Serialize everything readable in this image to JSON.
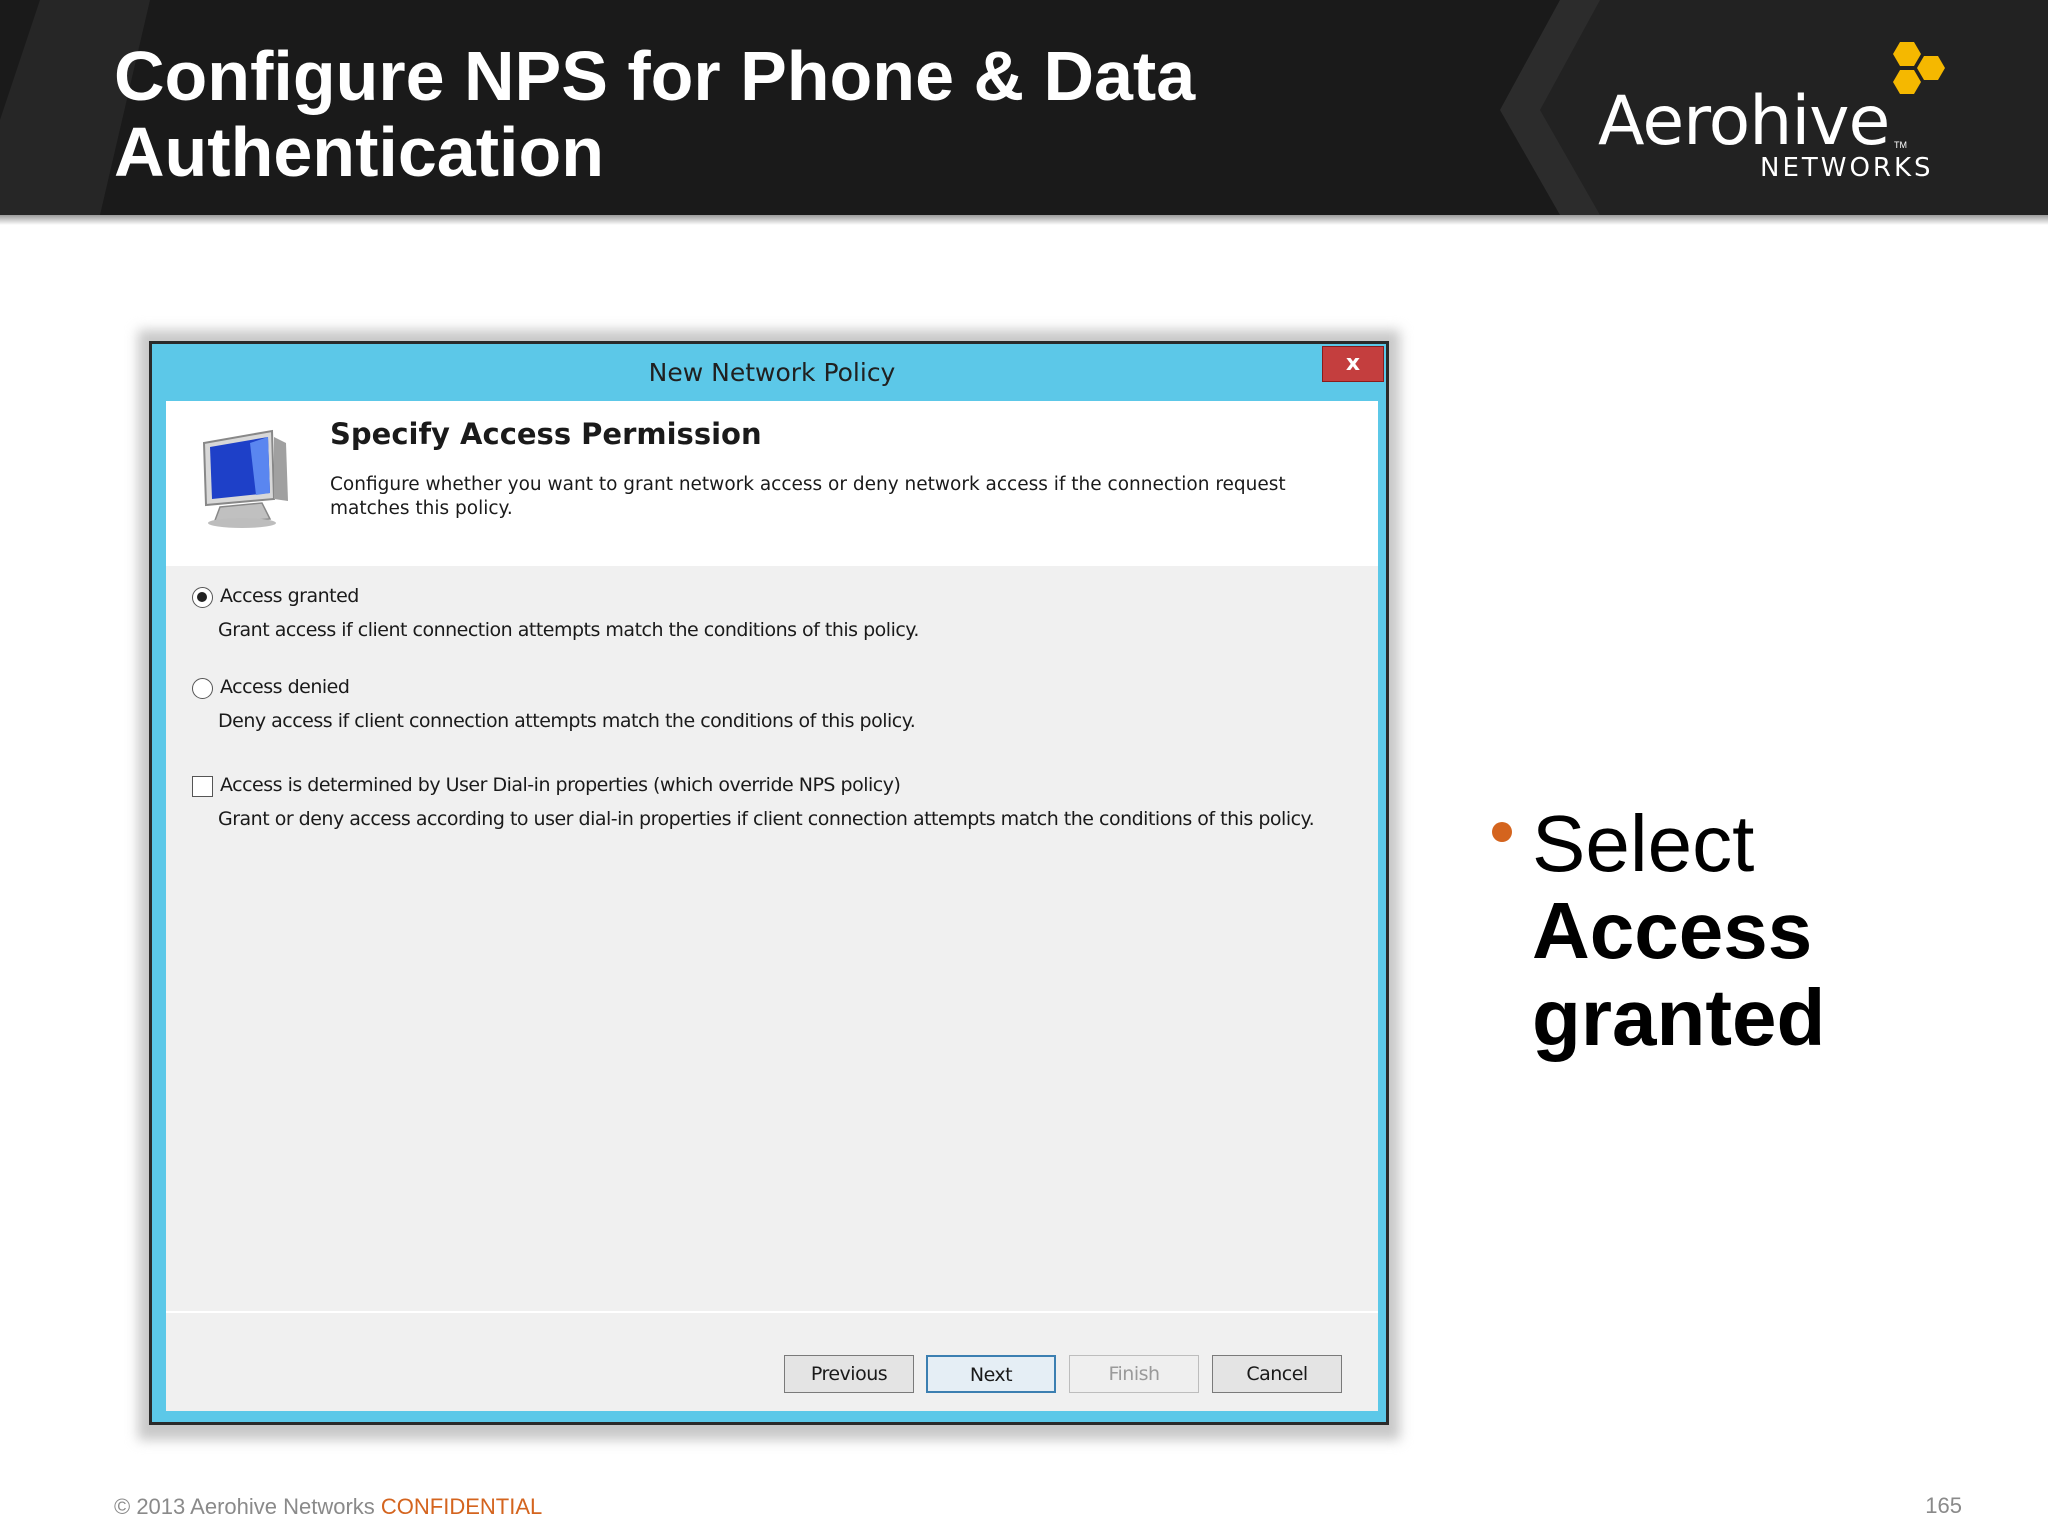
{
  "slide": {
    "title_line1": "Configure NPS for Phone & Data",
    "title_line2": "Authentication"
  },
  "logo": {
    "wordmark": "Aerohive",
    "trademark": "TM",
    "subtitle": "NETWORKS",
    "hex_color": "#f5b800"
  },
  "dialog": {
    "title": "New Network Policy",
    "close_label": "x",
    "heading": "Specify Access Permission",
    "description": "Configure whether you want to grant network access or deny network access if the connection request matches this policy.",
    "options": [
      {
        "label": "Access granted",
        "description": "Grant access if client connection attempts match the conditions of this policy.",
        "type": "radio",
        "checked": true
      },
      {
        "label": "Access denied",
        "description": "Deny access if client connection attempts match the conditions of this policy.",
        "type": "radio",
        "checked": false
      },
      {
        "label": "Access is determined by User Dial-in properties (which override NPS policy)",
        "description": "Grant or deny access according to user dial-in properties if client connection attempts match the conditions of this policy.",
        "type": "checkbox",
        "checked": false
      }
    ],
    "buttons": {
      "previous": "Previous",
      "next": "Next",
      "finish": "Finish",
      "cancel": "Cancel"
    }
  },
  "bullet": {
    "prefix": "Select",
    "emphasis_line1": "Access",
    "emphasis_line2": "granted"
  },
  "footer": {
    "copyright": "© 2013 Aerohive Networks ",
    "confidential": "CONFIDENTIAL",
    "page_number": "165"
  },
  "colors": {
    "banner": "#1a1a1a",
    "dialog_frame": "#5cc8e8",
    "accent_orange": "#d4641e"
  }
}
